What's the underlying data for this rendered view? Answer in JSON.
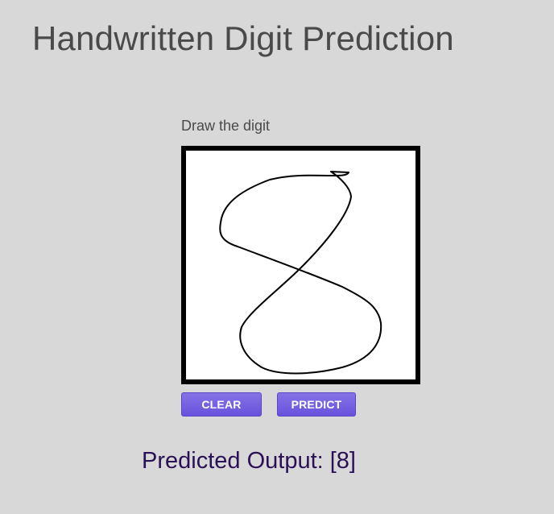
{
  "header": {
    "title": "Handwritten Digit Prediction"
  },
  "canvas": {
    "label": "Draw the digit",
    "drawn_digit": "8"
  },
  "buttons": {
    "clear_label": "CLEAR",
    "predict_label": "PREDICT"
  },
  "result": {
    "text": "Predicted Output: [8]"
  },
  "colors": {
    "background": "#d9d8d9",
    "button": "#6f59e0",
    "title_text": "#4a4a4a",
    "output_text": "#2a1155"
  }
}
